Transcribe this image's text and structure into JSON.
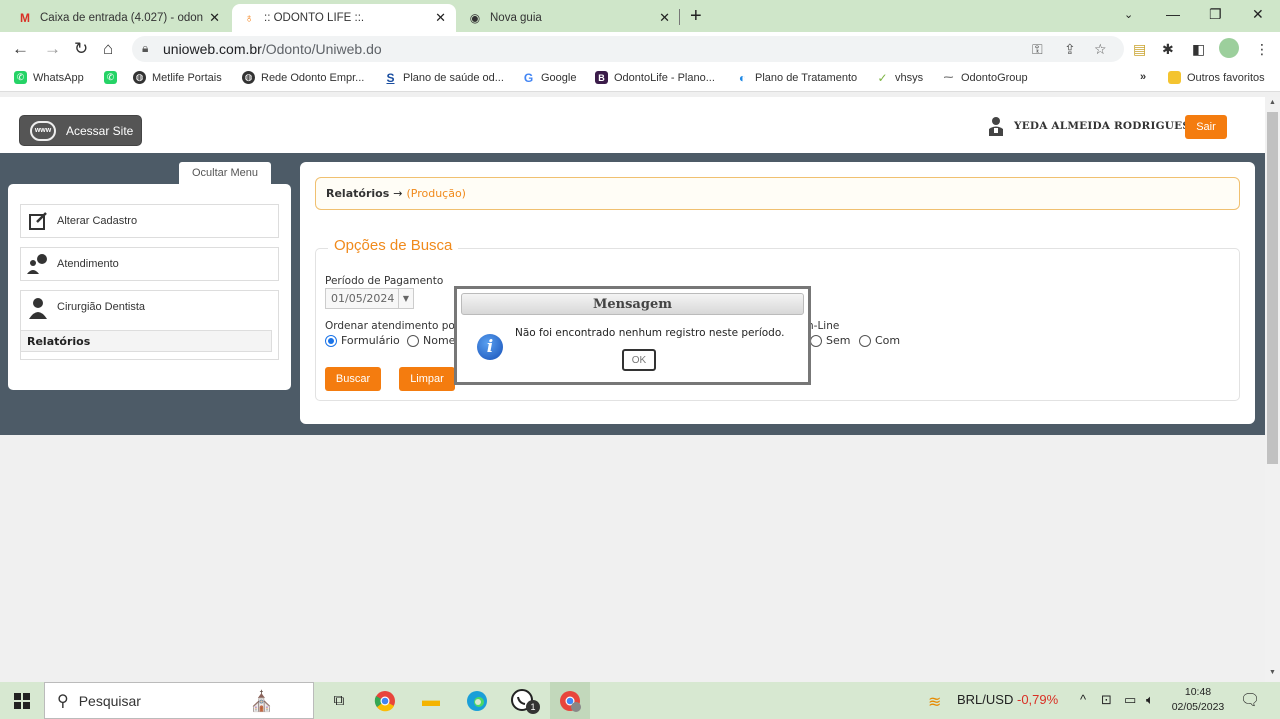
{
  "browser": {
    "tabs": [
      {
        "label": "Caixa de entrada (4.027) - odont",
        "icon": "gmail-icon",
        "active": false
      },
      {
        "label": ":: ODONTO LIFE ::.",
        "icon": "odonto-icon",
        "active": true
      },
      {
        "label": "Nova guia",
        "icon": "chrome-icon",
        "active": false
      }
    ],
    "url_domain": "unioweb.com.br",
    "url_path": "/Odonto/Uniweb.do",
    "bookmarks": [
      "WhatsApp",
      "",
      "Metlife Portais",
      "Rede Odonto Empr...",
      "Plano de saúde od...",
      "Google",
      "OdontoLife - Plano...",
      "Plano de Tratamento",
      "vhsys",
      "OdontoGroup"
    ],
    "other_bookmarks": "Outros favoritos",
    "more_bookmarks": "»"
  },
  "header": {
    "site_button": "Acessar Site",
    "www_badge": "www",
    "user_name": "YEDA ALMEIDA RODRIGUES",
    "logout": "Sair"
  },
  "sidebar": {
    "toggle": "Ocultar Menu",
    "items": [
      {
        "label": "Alterar Cadastro",
        "icon": "edit-icon"
      },
      {
        "label": "Atendimento",
        "icon": "speaker-person-icon"
      },
      {
        "label": "Cirurgião Dentista",
        "icon": "person-icon"
      }
    ],
    "sub_item": "Relatórios"
  },
  "main": {
    "breadcrumb_title": "Relatórios",
    "breadcrumb_arrow": "→",
    "breadcrumb_sub": "(Produção)",
    "legend": "Opções de Busca",
    "period_label": "Período de Pagamento",
    "period_value": "01/05/2024",
    "order_label": "Ordenar atendimento po",
    "order_options": [
      "Formulário",
      "Nome"
    ],
    "online_label": "n-Line",
    "online_options": [
      "Sem",
      "Com"
    ],
    "search_button": "Buscar",
    "clear_button": "Limpar"
  },
  "dialog": {
    "title": "Mensagem",
    "message": "Não foi encontrado nenhum registro neste período.",
    "ok": "OK"
  },
  "taskbar": {
    "search_placeholder": "Pesquisar",
    "currency": "BRL/USD",
    "currency_change": "-0,79%",
    "time": "10:48",
    "date": "02/05/2023",
    "whatsapp_badge": "1"
  },
  "colors": {
    "accent_orange": "#f47c0f",
    "band": "#4d5b67",
    "negative": "#d93025"
  }
}
